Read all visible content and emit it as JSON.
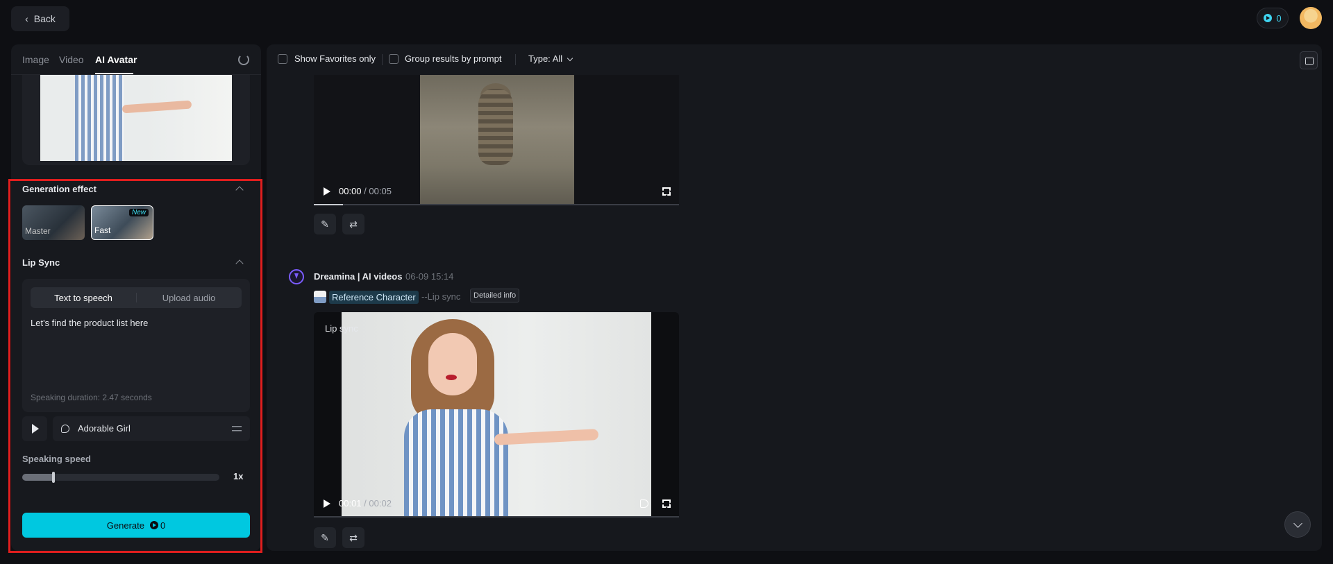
{
  "topbar": {
    "back_label": "Back",
    "credits": "0"
  },
  "left_panel": {
    "tabs": [
      {
        "label": "Image"
      },
      {
        "label": "Video"
      },
      {
        "label": "AI Avatar",
        "active": true
      }
    ],
    "generation_effect": {
      "title": "Generation effect",
      "options": [
        {
          "label": "Master",
          "selected": false
        },
        {
          "label": "Fast",
          "badge": "New",
          "selected": true
        }
      ]
    },
    "lip_sync": {
      "title": "Lip Sync",
      "modes": [
        {
          "label": "Text to speech",
          "active": true
        },
        {
          "label": "Upload audio",
          "active": false
        }
      ],
      "text": "Let's find the product list here",
      "duration": "Speaking duration: 2.47 seconds",
      "voice": "Adorable Girl"
    },
    "speaking_speed": {
      "title": "Speaking speed",
      "value_label": "1x",
      "level": 0.16
    },
    "generate": {
      "label": "Generate",
      "cost": "0"
    }
  },
  "main": {
    "filters": {
      "show_favorites": "Show Favorites only",
      "group_results": "Group results by prompt",
      "type": "Type: All"
    },
    "video1": {
      "time_current": "00:00",
      "time_separator": "/",
      "time_total": "00:05",
      "progress": 0.08
    },
    "generation": {
      "author": "Dreamina | AI videos",
      "timestamp": "06-09  15:14",
      "reference": "Reference Character",
      "tag": "--Lip sync",
      "info": "Detailed info"
    },
    "video2": {
      "label": "Lip sync",
      "time_current": "00:01",
      "time_separator": "/",
      "time_total": "00:02",
      "progress": 0.0
    }
  },
  "colors": {
    "accent": "#00c8e0",
    "highlight": "#e01e1e",
    "brand_purple": "#7b5cff"
  }
}
